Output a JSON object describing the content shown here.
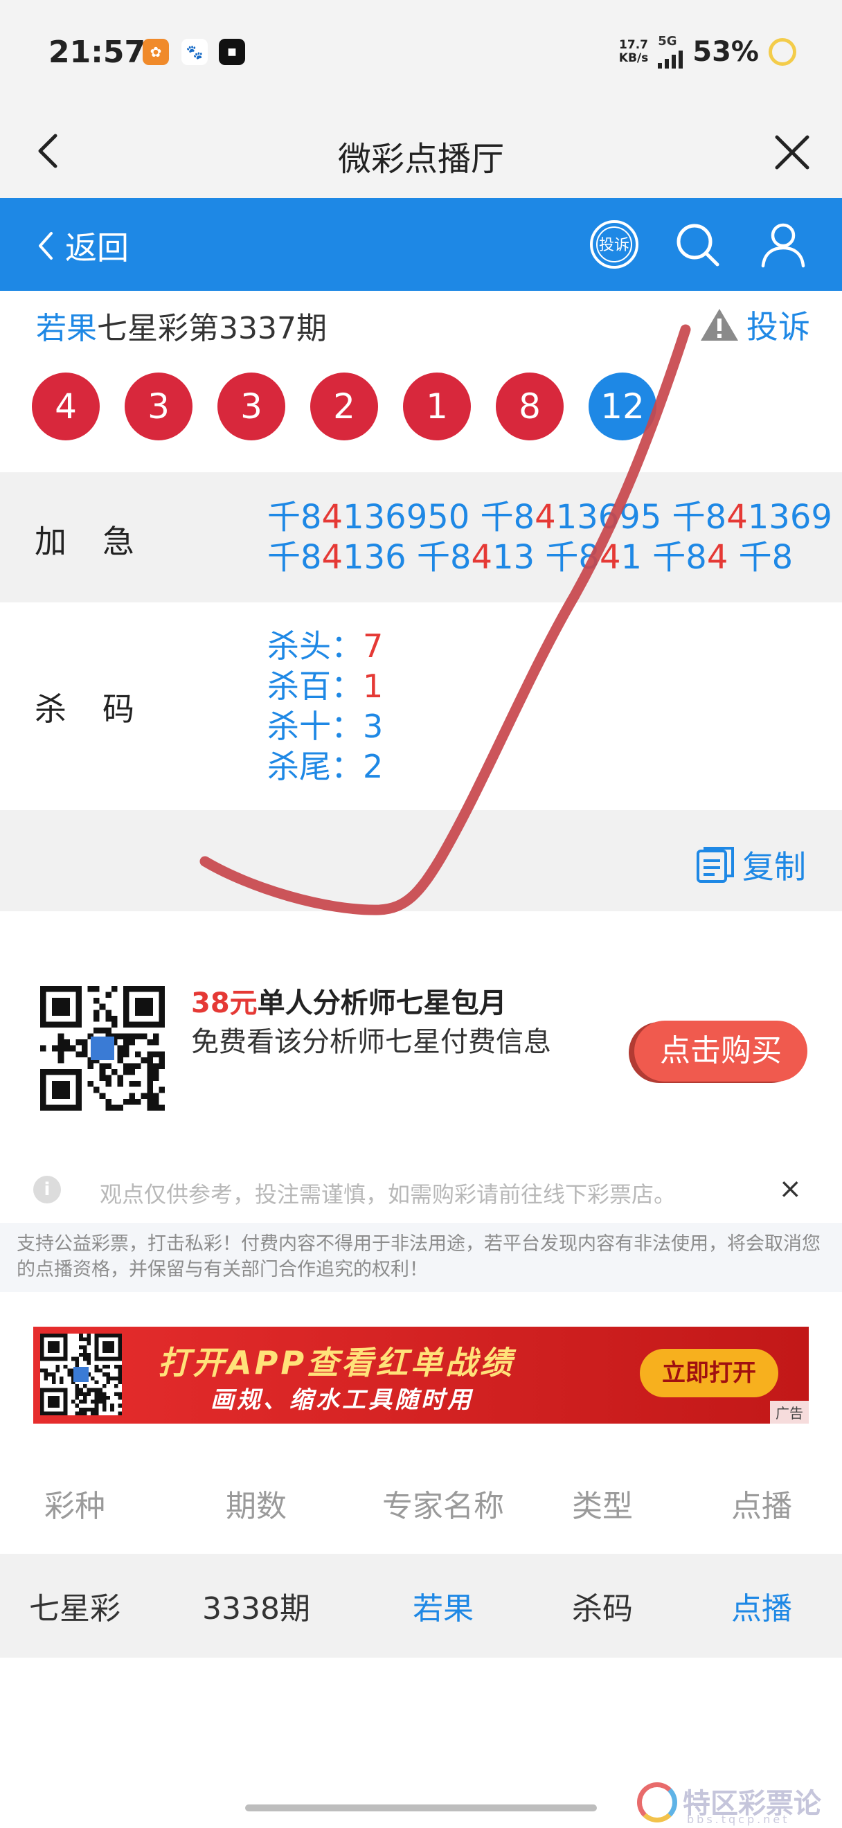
{
  "status_bar": {
    "time": "21:57",
    "app_icons": [
      "app-icon-orange",
      "paw-icon",
      "app-icon-black"
    ],
    "net_speed_value": "17.7",
    "net_speed_unit": "KB/s",
    "network": "5G",
    "battery": "53%"
  },
  "title_bar": {
    "title": "微彩点播厅"
  },
  "nav": {
    "back_label": "返回",
    "complain_badge": "投诉"
  },
  "issue": {
    "expert": "若果",
    "title": "七星彩第3337期",
    "complain_label": "投诉",
    "balls": [
      "4",
      "3",
      "3",
      "2",
      "1",
      "8",
      "12"
    ]
  },
  "jiaji": {
    "label": "加急",
    "lines": [
      [
        [
          "千8",
          "b"
        ],
        [
          "4",
          "r"
        ],
        [
          "136950 千8",
          "b"
        ],
        [
          "4",
          "r"
        ],
        [
          "13695 千8",
          "b"
        ],
        [
          "4",
          "r"
        ],
        [
          "1369",
          "b"
        ]
      ],
      [
        [
          "千8",
          "b"
        ],
        [
          "4",
          "r"
        ],
        [
          "136 千8",
          "b"
        ],
        [
          "4",
          "r"
        ],
        [
          "13 千8",
          "b"
        ],
        [
          "4",
          "r"
        ],
        [
          "1 千8",
          "b"
        ],
        [
          "4",
          "r"
        ],
        [
          " 千8",
          "b"
        ]
      ]
    ]
  },
  "shama": {
    "label": "杀码",
    "items": [
      {
        "label": "杀头：",
        "value": "7",
        "highlight": true
      },
      {
        "label": "杀百：",
        "value": "1",
        "highlight": true
      },
      {
        "label": "杀十：",
        "value": "3",
        "highlight": false
      },
      {
        "label": "杀尾：",
        "value": "2",
        "highlight": false
      }
    ]
  },
  "copy_label": "复制",
  "promo": {
    "price": "38元",
    "title_rest": "单人分析师七星包月",
    "subtitle": "免费看该分析师七星付费信息",
    "buy_label": "点击购买"
  },
  "notice": {
    "text": "观点仅供参考，投注需谨慎，如需购彩请前往线下彩票店。",
    "close": "×"
  },
  "disclaimer": "支持公益彩票，打击私彩！付费内容不得用于非法用途，若平台发现内容有非法使用，将会取消您的点播资格，并保留与有关部门合作追究的权利！",
  "banner": {
    "line1": "打开APP查看红单战绩",
    "line2": "画规、缩水工具随时用",
    "button": "立即打开",
    "ad_tag": "广告"
  },
  "table": {
    "headers": [
      "彩种",
      "期数",
      "专家名称",
      "类型",
      "点播"
    ],
    "row": [
      "七星彩",
      "3338期",
      "若果",
      "杀码",
      "点播"
    ]
  },
  "watermark": {
    "text": "特区彩票论坛",
    "url": "bbs.tqcp.net"
  },
  "colors": {
    "brand_blue": "#1e88e5",
    "ball_red": "#d8283c",
    "highlight_red": "#e53935",
    "stroke_red": "#c8474c"
  }
}
